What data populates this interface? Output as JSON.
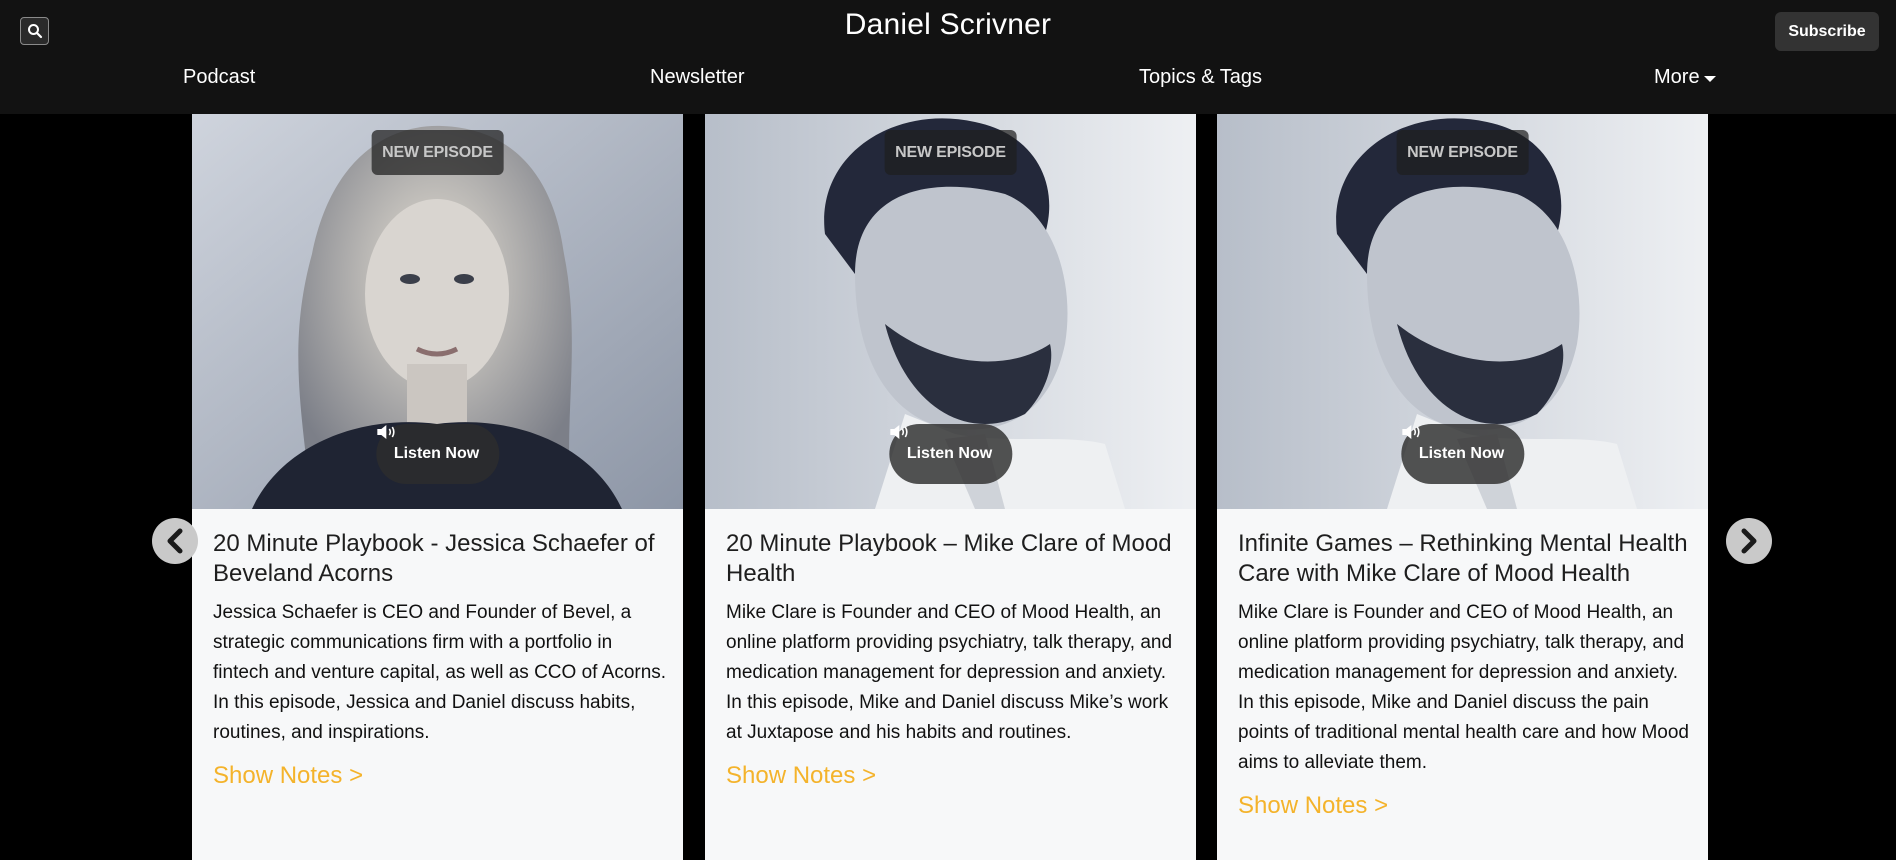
{
  "header": {
    "title": "Daniel Scrivner",
    "subscribe_label": "Subscribe",
    "search_icon": "search-icon"
  },
  "nav": {
    "items": [
      {
        "label": "Podcast"
      },
      {
        "label": "Newsletter"
      },
      {
        "label": "Topics & Tags"
      },
      {
        "label": "More"
      }
    ]
  },
  "carousel": {
    "prev_icon": "chevron-left-icon",
    "next_icon": "chevron-right-icon",
    "cards": [
      {
        "badge": "NEW EPISODE",
        "listen_label": "Listen Now",
        "title": "20 Minute Playbook - Jessica Schaefer of Beveland Acorns",
        "description": "Jessica Schaefer is CEO and Founder of Bevel, a strategic communications firm with a portfolio in fintech and venture capital, as well as CCO of Acorns. In this episode, Jessica and Daniel discuss habits, routines, and inspirations.",
        "link_label": "Show Notes >"
      },
      {
        "badge": "NEW EPISODE",
        "listen_label": "Listen Now",
        "title": "20 Minute Playbook – Mike Clare of Mood Health",
        "description": "Mike Clare is Founder and CEO of Mood Health, an online platform providing psychiatry, talk therapy, and medication management for depression and anxiety. In this episode, Mike and Daniel discuss Mike’s work at Juxtapose and his habits and routines.",
        "link_label": "Show Notes >"
      },
      {
        "badge": "NEW EPISODE",
        "listen_label": "Listen Now",
        "title": "Infinite Games – Rethinking Mental Health Care with Mike Clare of Mood Health",
        "description": "Mike Clare is Founder and CEO of Mood Health, an online platform providing psychiatry, talk therapy, and medication management for depression and anxiety. In this episode, Mike and Daniel discuss the pain points of traditional mental health care and how Mood aims to alleviate them.",
        "link_label": "Show Notes >"
      }
    ]
  },
  "colors": {
    "header_bg": "#121212",
    "page_bg": "#000000",
    "card_bg": "#f7f8f9",
    "link_accent": "#f4b32b"
  }
}
